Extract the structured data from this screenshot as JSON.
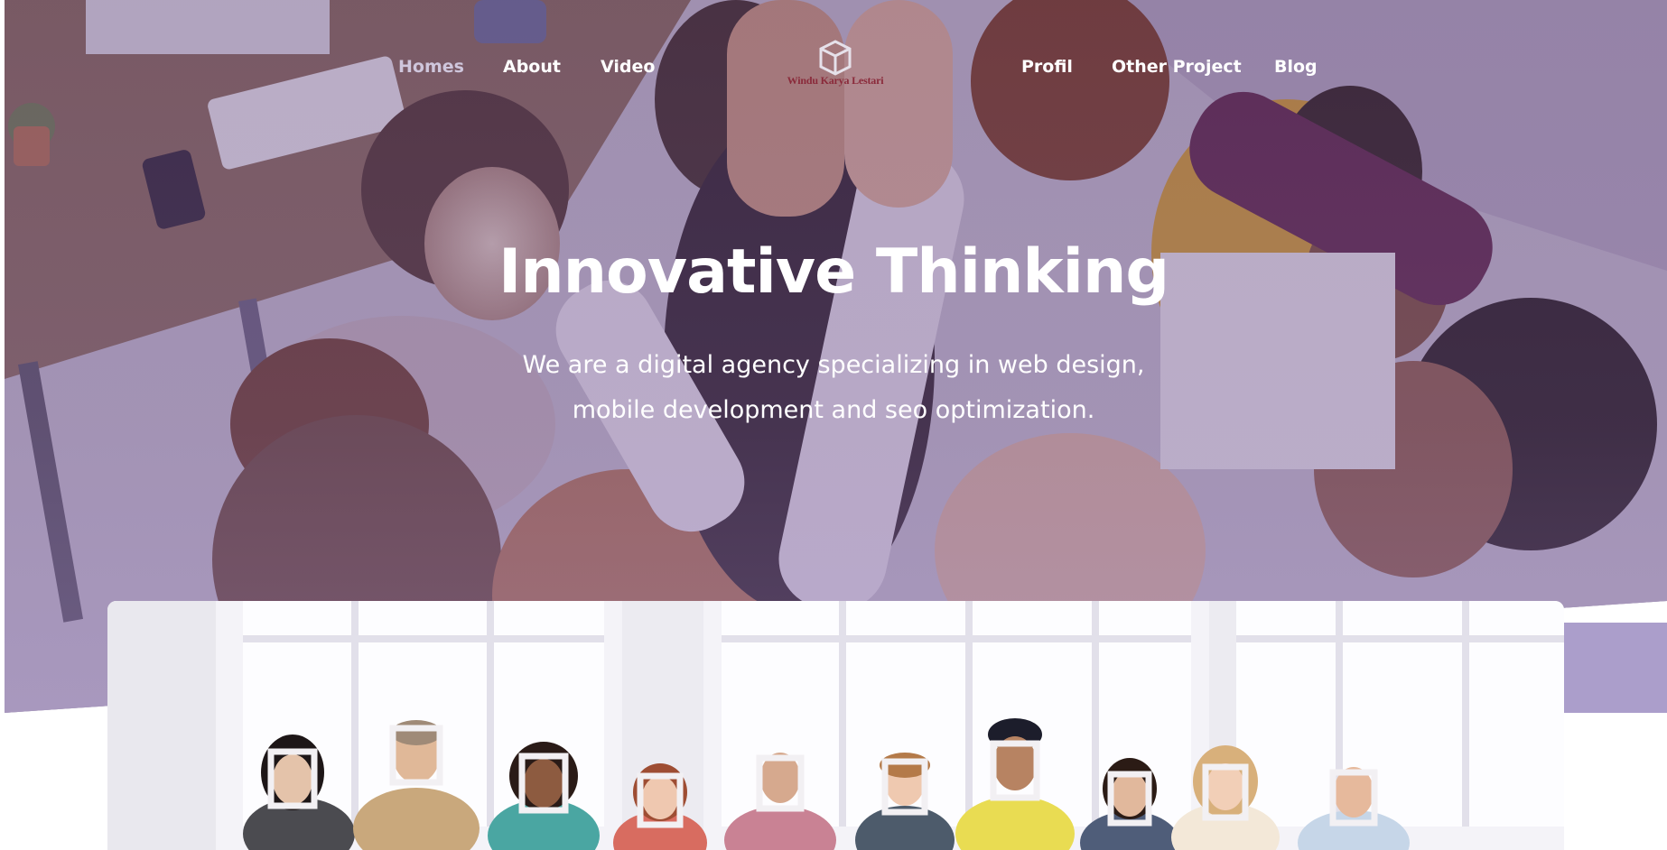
{
  "nav": {
    "left": [
      {
        "label": "Homes",
        "active": true
      },
      {
        "label": "About",
        "active": false
      },
      {
        "label": "Video",
        "active": false
      }
    ],
    "right": [
      {
        "label": "Profil",
        "active": false
      },
      {
        "label": "Other Project",
        "active": false
      },
      {
        "label": "Blog",
        "active": false
      }
    ]
  },
  "logo": {
    "text": "Windu Karya Lestari",
    "icon": "cube-logo-icon"
  },
  "hero": {
    "title": "Innovative Thinking",
    "subtitle": "We are a digital agency specializing in web design, mobile development and seo optimization."
  },
  "colors": {
    "overlay": "#6e528c",
    "band": "#ab9ecb",
    "text": "#ffffff",
    "active_nav": "#cfc6dc"
  }
}
